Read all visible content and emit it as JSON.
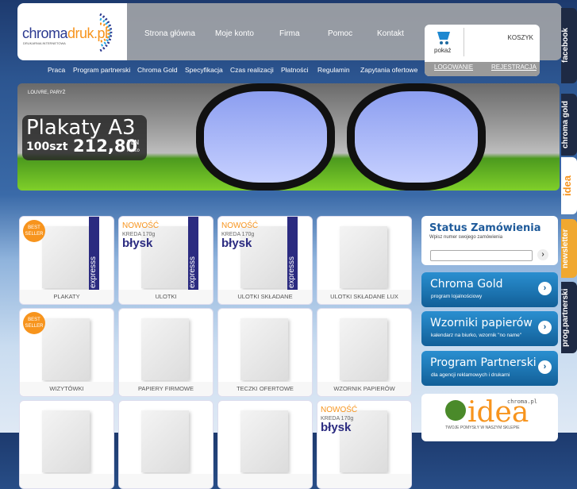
{
  "logo": {
    "name_a": "chroma",
    "name_b": "druk.pl",
    "tagline": "DRUKARNIA INTERNETOWA"
  },
  "nav": [
    "Strona główna",
    "Moje konto",
    "Firma",
    "Pomoc",
    "Kontakt"
  ],
  "cart": {
    "show": "pokaż",
    "title": "KOSZYK",
    "login": "LOGOWANIE",
    "register": "REJESTRACJA"
  },
  "subnav": [
    "Praca",
    "Program partnerski",
    "Chroma Gold",
    "Specyfikacja",
    "Czas realizacji",
    "Płatności",
    "Regulamin",
    "Zapytania ofertowe"
  ],
  "banner": {
    "caption": "LOUVRE, PARYŻ",
    "title": "Plakaty A3",
    "qty": "100szt",
    "price": "212,80",
    "currency": "PLN",
    "net": "netto"
  },
  "badges": {
    "best": "BEST SELLER",
    "new": "NOWOŚĆ",
    "paper": "KREDA 170g",
    "gloss": "błysk",
    "express": "expresss"
  },
  "products": [
    {
      "label": "PLAKATY",
      "best": true,
      "express": true
    },
    {
      "label": "ULOTKI",
      "new": true,
      "express": true
    },
    {
      "label": "ULOTKI SKŁADANE",
      "new": true,
      "express": true
    },
    {
      "label": "ULOTKI SKŁADANE LUX"
    },
    {
      "label": "WIZYTÓWKI",
      "best": true
    },
    {
      "label": "PAPIERY FIRMOWE"
    },
    {
      "label": "TECZKI OFERTOWE"
    },
    {
      "label": "WZORNIK PAPIERÓW"
    },
    {
      "label": ""
    },
    {
      "label": ""
    },
    {
      "label": ""
    },
    {
      "label": "",
      "new": true
    }
  ],
  "status": {
    "title": "Status Zamówienia",
    "hint": "Wpisz numer swojego zamówienia",
    "value": ""
  },
  "promos": [
    {
      "title": "Chroma Gold",
      "desc": "program lojalnościowy"
    },
    {
      "title": "Wzorniki papierów",
      "desc": "kalendarz na biurko, wzornik \"no name\""
    },
    {
      "title": "Program Partnerski",
      "desc": "dla agencji reklamowych i drukarni"
    }
  ],
  "idea": {
    "brand": "chroma.pl",
    "word": "idea",
    "slogan": "TWOJE POMYSŁY W NASZYM SKLEPIE"
  },
  "tabs": [
    "facebook",
    "chroma gold",
    "idea",
    "newsletter",
    "prog.partnerski"
  ]
}
